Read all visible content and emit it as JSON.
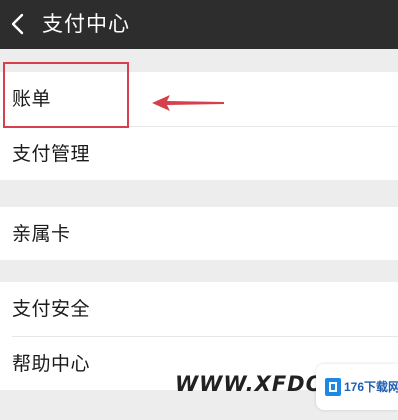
{
  "header": {
    "title": "支付中心",
    "back_icon": "chevron-left-icon"
  },
  "menu": {
    "bill": "账单",
    "payment_management": "支付管理",
    "family_card": "亲属卡",
    "payment_security": "支付安全",
    "help_center": "帮助中心"
  },
  "annotation": {
    "box_color": "#d6404a",
    "arrow_color": "#d6404a"
  },
  "watermark": {
    "text": "WWW.XFDOW",
    "badge": "176下载网"
  },
  "colors": {
    "titlebar": "#2d2d2d",
    "background": "#ededed",
    "item_background": "#ffffff"
  }
}
